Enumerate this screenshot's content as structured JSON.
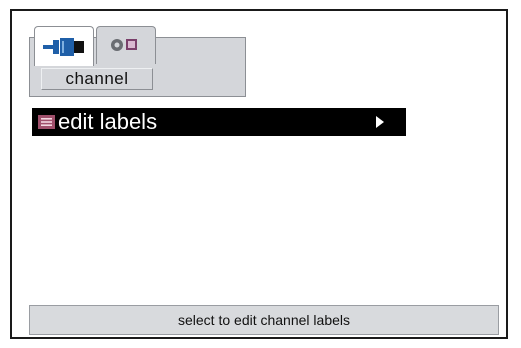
{
  "tabs": [
    {
      "icon": "cable-connector-icon",
      "selected": true
    },
    {
      "icon": "record-settings-icon",
      "selected": false
    }
  ],
  "section": {
    "label": "channel"
  },
  "menu": {
    "items": [
      {
        "icon": "labels-icon",
        "label": "edit labels",
        "selected": true,
        "has_submenu": true
      }
    ]
  },
  "status_bar": {
    "text": "select to edit channel labels"
  },
  "colors": {
    "highlight_bg": "#000000",
    "highlight_text": "#ffffff",
    "panel": "#d4d6da",
    "connector_blue": "#1f5fa8",
    "label_icon": "#a0506c"
  }
}
